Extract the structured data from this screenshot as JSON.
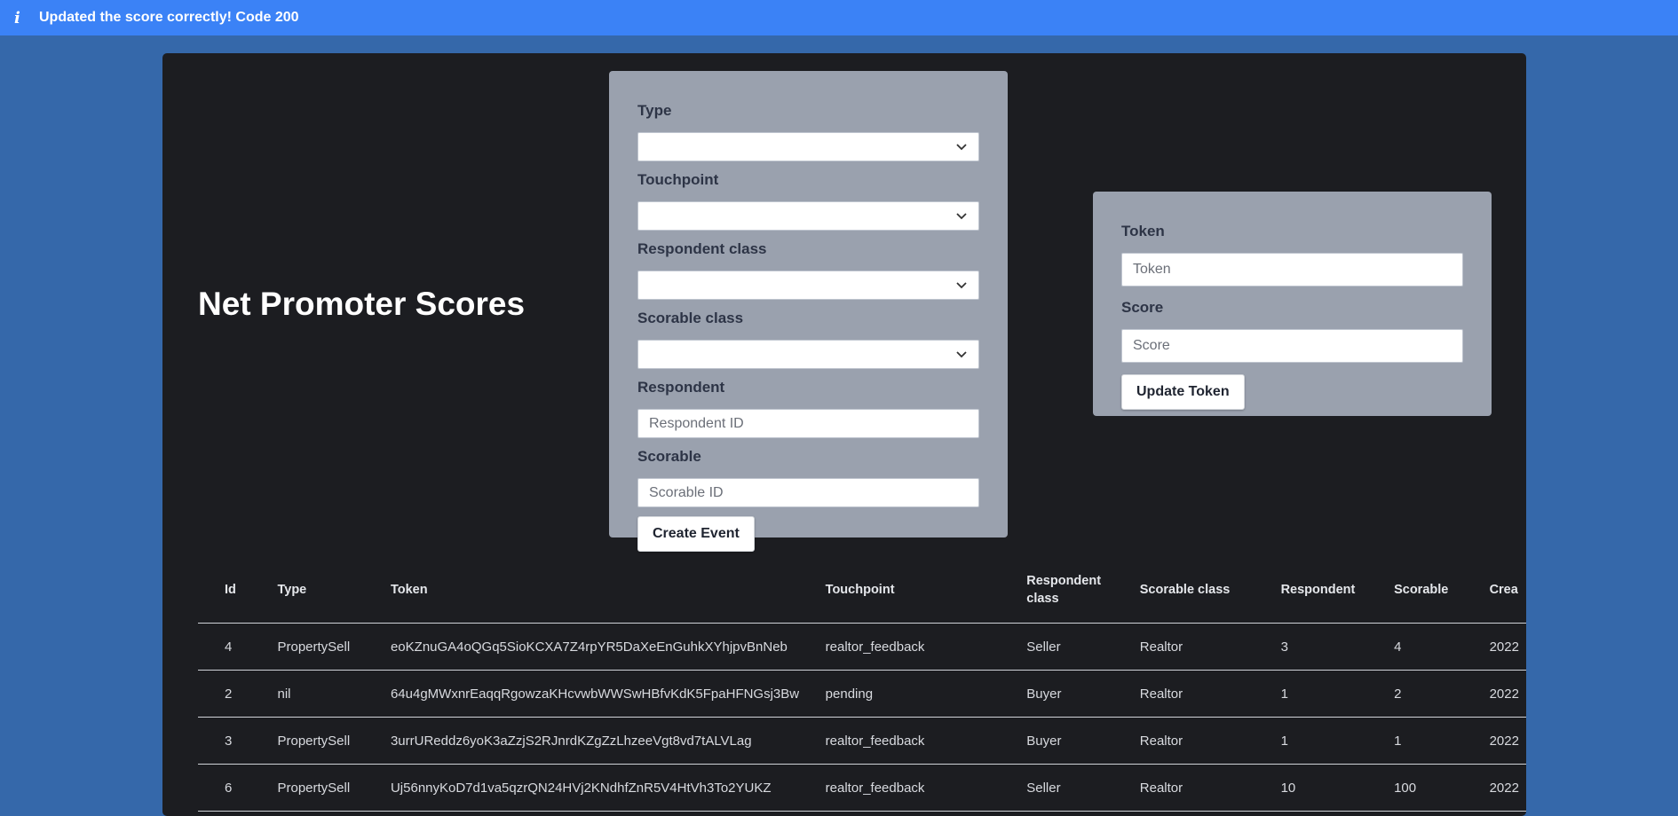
{
  "notice": {
    "icon": "info-icon",
    "text": "Updated the score correctly! Code 200"
  },
  "page": {
    "title": "Net Promoter Scores"
  },
  "event_form": {
    "type_label": "Type",
    "touchpoint_label": "Touchpoint",
    "respondent_class_label": "Respondent class",
    "scorable_class_label": "Scorable class",
    "respondent_label": "Respondent",
    "respondent_placeholder": "Respondent ID",
    "scorable_label": "Scorable",
    "scorable_placeholder": "Scorable ID",
    "submit_label": "Create Event"
  },
  "token_form": {
    "token_label": "Token",
    "token_placeholder": "Token",
    "score_label": "Score",
    "score_placeholder": "Score",
    "submit_label": "Update Token"
  },
  "table": {
    "columns": [
      "Id",
      "Type",
      "Token",
      "Touchpoint",
      "Respondent class",
      "Scorable class",
      "Respondent",
      "Scorable",
      "Crea"
    ],
    "rows": [
      [
        "4",
        "PropertySell",
        "eoKZnuGA4oQGq5SioKCXA7Z4rpYR5DaXeEnGuhkXYhjpvBnNeb",
        "realtor_feedback",
        "Seller",
        "Realtor",
        "3",
        "4",
        "2022"
      ],
      [
        "2",
        "nil",
        "64u4gMWxnrEaqqRgowzaKHcvwbWWSwHBfvKdK5FpaHFNGsj3Bw",
        "pending",
        "Buyer",
        "Realtor",
        "1",
        "2",
        "2022"
      ],
      [
        "3",
        "PropertySell",
        "3urrUReddz6yoK3aZzjS2RJnrdKZgZzLhzeeVgt8vd7tALVLag",
        "realtor_feedback",
        "Buyer",
        "Realtor",
        "1",
        "1",
        "2022"
      ],
      [
        "6",
        "PropertySell",
        "Uj56nnyKoD7d1va5qzrQN24HVj2KNdhfZnR5V4HtVh3To2YUKZ",
        "realtor_feedback",
        "Seller",
        "Realtor",
        "10",
        "100",
        "2022"
      ]
    ]
  },
  "colors": {
    "banner": "#3b82f6",
    "background": "#3568aa",
    "panel": "#1c1d21",
    "card": "#9aa1ae"
  }
}
